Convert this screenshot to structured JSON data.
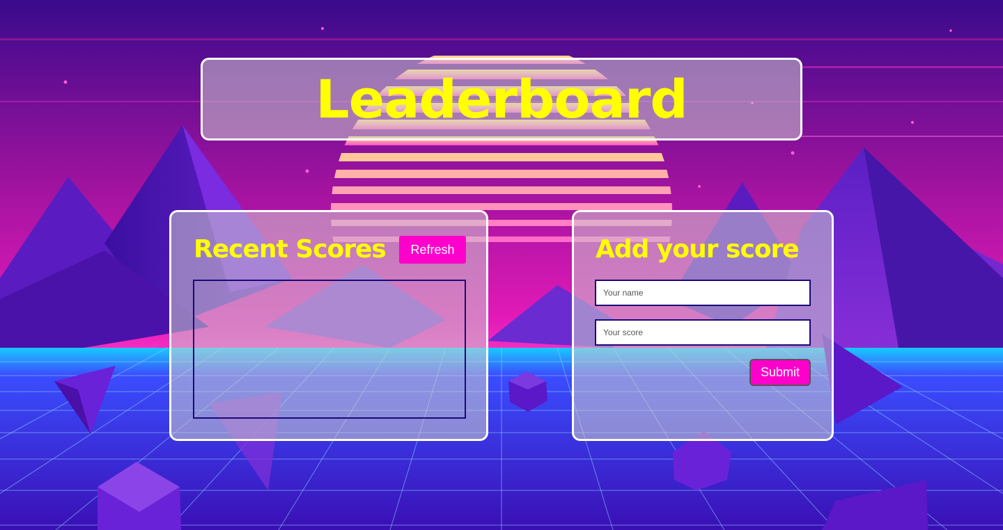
{
  "page": {
    "title": "Leaderboard"
  },
  "recent_scores": {
    "heading": "Recent Scores",
    "refresh_label": "Refresh",
    "entries": []
  },
  "add_score": {
    "heading": "Add your score",
    "name_placeholder": "Your name",
    "score_placeholder": "Your score",
    "submit_label": "Submit"
  },
  "colors": {
    "title_yellow": "#ffff00",
    "button_magenta": "#ff00cc",
    "panel_border": "#ffffff",
    "field_border": "#1b0878"
  },
  "background": {
    "description_icon": "synthwave-landscape-icon"
  }
}
